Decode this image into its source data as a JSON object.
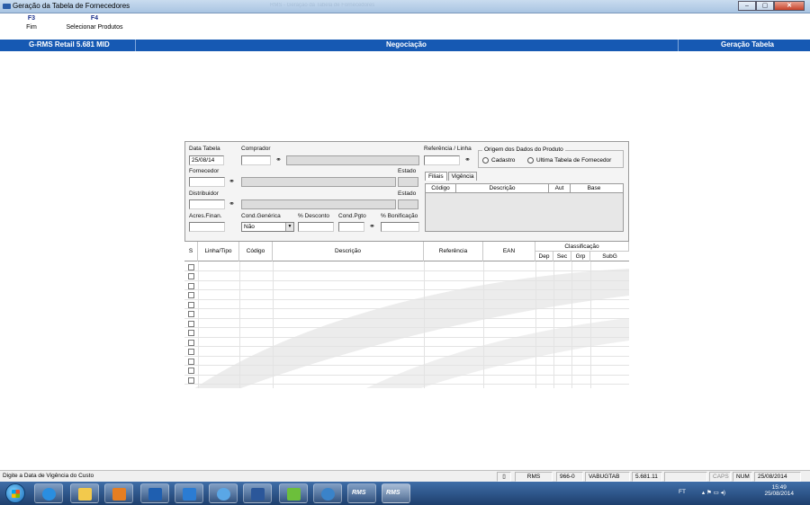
{
  "window": {
    "title": "Geração da Tabela de Fornecedores",
    "background_title": "RMS - Geração da Tabela de Fornecedores",
    "buttons": [
      "–",
      "▢",
      "✕"
    ]
  },
  "fkeys": [
    {
      "key": "F3",
      "label": "Fim"
    },
    {
      "key": "F4",
      "label": "Selecionar Produtos"
    }
  ],
  "header": {
    "left": "G-RMS Retail 5.681 MID",
    "center": "Negociação",
    "right": "Geração Tabela"
  },
  "form": {
    "data_tabela_label": "Data Tabela",
    "data_tabela_value": "25/08/14",
    "comprador_label": "Comprador",
    "referencia_label": "Referência / Linha",
    "origem_label": "Origem dos Dados do Produto",
    "origem_options": [
      "Cadastro",
      "Ultima Tabela de Fornecedor"
    ],
    "fornecedor_label": "Fornecedor",
    "estado_label_1": "Estado",
    "distribuidor_label": "Distribuidor",
    "estado_label_2": "Estado",
    "acres_label": "Acres.Finan.",
    "cond_generica_label": "Cond.Genérica",
    "cond_generica_value": "Não",
    "desconto_label": "% Desconto",
    "cond_pgto_label": "Cond.Pgto",
    "bonificacao_label": "% Bonificação"
  },
  "tabs": [
    "Filiais",
    "Vigência"
  ],
  "filiais_table": {
    "headers": [
      "Código",
      "Descrição",
      "Aut",
      "Base"
    ]
  },
  "grid": {
    "headers": [
      "S",
      "Linha/Tipo",
      "Código",
      "Descrição",
      "Referência",
      "EAN"
    ],
    "group_header": "Classificação",
    "sub_headers": [
      "Dep",
      "Sec",
      "Grp",
      "SubG"
    ],
    "row_count": 13
  },
  "statusbar": {
    "message": "Digite a Data de Vigência do Custo",
    "system": "RMS",
    "code": "966-0",
    "program": "VABUGTAB",
    "version": "5.681.11",
    "caps": "CAPS",
    "num": "NUM",
    "date": "25/08/2014"
  },
  "taskbar": {
    "rms_label": "RMS",
    "lang": "FT",
    "time": "15:49",
    "date": "25/08/2014"
  }
}
